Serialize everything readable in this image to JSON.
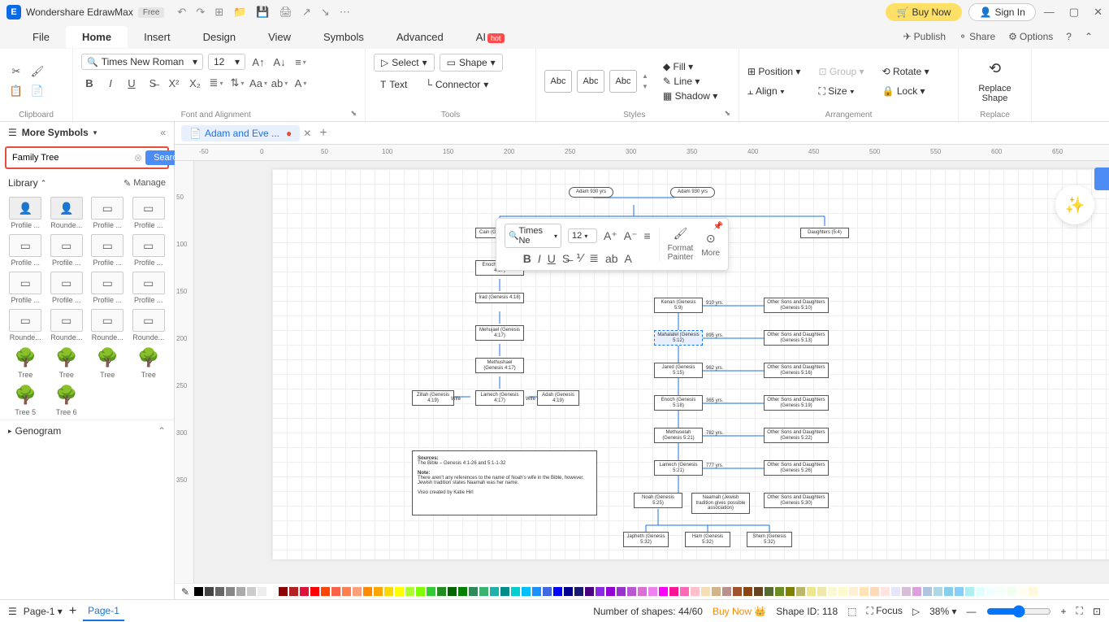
{
  "titlebar": {
    "app_name": "Wondershare EdrawMax",
    "badge": "Free",
    "buy_now": "Buy Now",
    "sign_in": "Sign In"
  },
  "menu": {
    "tabs": [
      "File",
      "Home",
      "Insert",
      "Design",
      "View",
      "Symbols",
      "Advanced",
      "AI"
    ],
    "active": 1,
    "hot_label": "hot",
    "right": {
      "publish": "Publish",
      "share": "Share",
      "options": "Options"
    }
  },
  "ribbon": {
    "clipboard": "Clipboard",
    "font_name": "Times New Roman",
    "font_size": "12",
    "font_align_label": "Font and Alignment",
    "select": "Select",
    "shape": "Shape",
    "text": "Text",
    "connector": "Connector",
    "tools_label": "Tools",
    "abc": "Abc",
    "fill": "Fill",
    "line": "Line",
    "shadow": "Shadow",
    "styles_label": "Styles",
    "position": "Position",
    "align": "Align",
    "group": "Group",
    "size": "Size",
    "rotate": "Rotate",
    "lock": "Lock",
    "arrangement_label": "Arrangement",
    "replace_shape": "Replace\nShape",
    "replace_label": "Replace"
  },
  "left_panel": {
    "more_symbols": "More Symbols",
    "search_value": "Family Tree",
    "search_button": "Search",
    "library": "Library",
    "manage": "Manage",
    "shapes": [
      {
        "label": "Profile ...",
        "kind": "profile"
      },
      {
        "label": "Rounde...",
        "kind": "profile"
      },
      {
        "label": "Profile ...",
        "kind": "card"
      },
      {
        "label": "Profile ...",
        "kind": "card"
      },
      {
        "label": "Profile ...",
        "kind": "card"
      },
      {
        "label": "Profile ...",
        "kind": "card"
      },
      {
        "label": "Profile ...",
        "kind": "card"
      },
      {
        "label": "Profile ...",
        "kind": "card"
      },
      {
        "label": "Profile ...",
        "kind": "card"
      },
      {
        "label": "Profile ...",
        "kind": "card"
      },
      {
        "label": "Profile ...",
        "kind": "card"
      },
      {
        "label": "Profile ...",
        "kind": "card"
      },
      {
        "label": "Rounde...",
        "kind": "card"
      },
      {
        "label": "Rounde...",
        "kind": "card"
      },
      {
        "label": "Rounde...",
        "kind": "card"
      },
      {
        "label": "Rounde...",
        "kind": "card"
      },
      {
        "label": "Tree",
        "kind": "tree"
      },
      {
        "label": "Tree",
        "kind": "tree"
      },
      {
        "label": "Tree",
        "kind": "tree"
      },
      {
        "label": "Tree",
        "kind": "tree"
      },
      {
        "label": "Tree 5",
        "kind": "tree"
      },
      {
        "label": "Tree 6",
        "kind": "tree"
      }
    ],
    "genogram": "Genogram"
  },
  "doc_tab": {
    "name": "Adam and Eve ..."
  },
  "diagram": {
    "adam1": "Adam\n930 yrs",
    "adam2": "Adam\n930 yrs",
    "cain": "Cain\n(Genesis 4:1)",
    "enoch1": "Enoch\n(Genesis 4:17)",
    "irad": "Irad\n(Genesis 4:18)",
    "mehujael": "Mehujael\n(Genesis 4:17)",
    "methushael": "Methushael\n(Genesis 4:17)",
    "lamech1": "Lamech\n(Genesis 4:17)",
    "zillah": "Zillah\n(Genesis 4:19)",
    "adah": "Adah\n(Genesis 4:19)",
    "kenan": "Kenan\n(Genesis 5:9)",
    "mahalalel": "Mahalalel\n(Genesis 5:12)",
    "jared": "Jared\n(Genesis 5:15)",
    "enoch2": "Enoch\n(Genesis 5:18)",
    "methuselah": "Methuselah\n(Genesis 5:21)",
    "lamech2": "Lamech\n(Genesis 5:21)",
    "noah": "Noah\n(Genesis 5:25)",
    "naamah": "Naamah\n(Jewish tradition gives possible association)",
    "japheth": "Japheth\n(Genesis 5:32)",
    "ham": "Ham\n(Genesis 5:32)",
    "shem": "Shem\n(Genesis 5:32)",
    "others_top": "Daughters\n(5:4)",
    "others": "Other Sons and Daughters",
    "others1": "(Genesis 5:10)",
    "others2": "(Genesis 5:13)",
    "others3": "(Genesis 5:16)",
    "others4": "(Genesis 5:19)",
    "others5": "(Genesis 5:22)",
    "others6": "(Genesis 5:26)",
    "others7": "(Genesis 5:30)",
    "age_910": "910 yrs.",
    "age_895": "895 yrs.",
    "age_962": "962 yrs.",
    "age_365": "365 yrs.",
    "age_782": "782 yrs.",
    "age_777": "777 yrs.",
    "wife": "Wife",
    "sources_head": "Sources:",
    "sources_body": "The Bible – Genesis 4:1-26 and 5:1-1-32",
    "note_head": "Note:",
    "note_body": "There aren't any references to the name of Noah's wife in the Bible, however, Jewish tradition states Naamah was her name.",
    "credit": "Visio created by Katie Hirl"
  },
  "float_toolbar": {
    "font": "Times Ne",
    "size": "12",
    "format_painter": "Format\nPainter",
    "more": "More"
  },
  "ruler_h": [
    "-50",
    "0",
    "50",
    "100",
    "150",
    "200",
    "250",
    "300",
    "350",
    "400",
    "450",
    "500",
    "550",
    "600",
    "650"
  ],
  "ruler_v": [
    "50",
    "100",
    "150",
    "200",
    "250",
    "300",
    "350"
  ],
  "statusbar": {
    "page_dropdown": "Page-1",
    "page_tab": "Page-1",
    "shapes_count": "Number of shapes: 44/60",
    "buy_now": "Buy Now",
    "shape_id": "Shape ID: 118",
    "focus": "Focus",
    "zoom": "38%"
  },
  "colors": [
    "#000",
    "#444",
    "#666",
    "#888",
    "#aaa",
    "#ccc",
    "#eee",
    "#fff",
    "#8b0000",
    "#b22222",
    "#dc143c",
    "#ff0000",
    "#ff4500",
    "#ff6347",
    "#ff7f50",
    "#ffa07a",
    "#ff8c00",
    "#ffa500",
    "#ffd700",
    "#ffff00",
    "#adff2f",
    "#7fff00",
    "#32cd32",
    "#228b22",
    "#006400",
    "#008000",
    "#2e8b57",
    "#3cb371",
    "#20b2aa",
    "#008b8b",
    "#00ced1",
    "#00bfff",
    "#1e90ff",
    "#4169e1",
    "#0000ff",
    "#00008b",
    "#191970",
    "#4b0082",
    "#8a2be2",
    "#9400d3",
    "#9932cc",
    "#ba55d3",
    "#da70d6",
    "#ee82ee",
    "#ff00ff",
    "#ff1493",
    "#ff69b4",
    "#ffc0cb",
    "#f5deb3",
    "#d2b48c",
    "#bc8f8f",
    "#a0522d",
    "#8b4513",
    "#654321",
    "#556b2f",
    "#6b8e23",
    "#808000",
    "#bdb76b",
    "#f0e68c",
    "#eee8aa",
    "#fafad2",
    "#fffacd",
    "#ffefd5",
    "#ffe4b5",
    "#ffdab9",
    "#ffe4e1",
    "#e6e6fa",
    "#d8bfd8",
    "#dda0dd",
    "#b0c4de",
    "#add8e6",
    "#87ceeb",
    "#87cefa",
    "#afeeee",
    "#e0ffff",
    "#f0ffff",
    "#f5fffa",
    "#f0fff0",
    "#fffff0",
    "#fff8dc"
  ]
}
